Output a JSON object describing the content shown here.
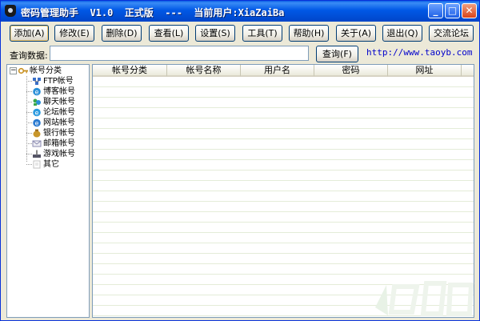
{
  "window": {
    "title": "密码管理助手  V1.0  正式版  ---  当前用户:XiaZaiBa",
    "minimize_glyph": "_",
    "maximize_glyph": "□",
    "close_glyph": "✕"
  },
  "toolbar": {
    "add": "添加(A)",
    "edit": "修改(E)",
    "delete": "删除(D)",
    "view": "查看(L)",
    "settings": "设置(S)",
    "tools": "工具(T)",
    "help": "帮助(H)",
    "about": "关于(A)",
    "exit": "退出(Q)",
    "forum": "交流论坛"
  },
  "search": {
    "label": "查询数据:",
    "value": "",
    "button": "查询(F)"
  },
  "website": "http://www.taoyb.com",
  "tree": {
    "root": "帐号分类",
    "root_toggle": "−",
    "items": [
      {
        "label": "FTP帐号",
        "icon": "ftp-icon",
        "color": "#3a6fc8"
      },
      {
        "label": "博客帐号",
        "icon": "blog-icon",
        "color": "#2a8fd8"
      },
      {
        "label": "聊天帐号",
        "icon": "chat-icon",
        "color": "#3aa84a"
      },
      {
        "label": "论坛帐号",
        "icon": "forum-icon",
        "color": "#2a9ae0"
      },
      {
        "label": "网站帐号",
        "icon": "website-icon",
        "color": "#2a7ad0"
      },
      {
        "label": "银行帐号",
        "icon": "bank-icon",
        "color": "#c8962a"
      },
      {
        "label": "邮箱帐号",
        "icon": "mail-icon",
        "color": "#8a8ab0"
      },
      {
        "label": "游戏帐号",
        "icon": "game-icon",
        "color": "#555566"
      },
      {
        "label": "其它",
        "icon": "other-icon",
        "color": "#c0c0c0"
      }
    ]
  },
  "list": {
    "columns": [
      "帐号分类",
      "帐号名称",
      "用户名",
      "密码",
      "网址"
    ]
  },
  "colors": {
    "titlebar": "#0058e6",
    "button_border": "#003c74",
    "link": "#0000cc"
  }
}
